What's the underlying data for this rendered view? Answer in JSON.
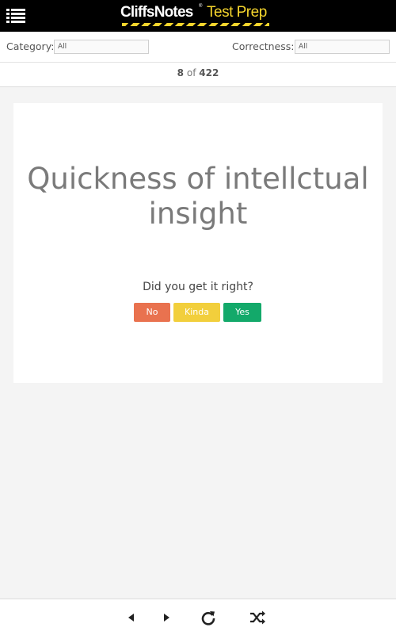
{
  "app": {
    "brand_primary": "CliffsNotes",
    "brand_secondary": "Test Prep",
    "registered": "®",
    "accent_color": "#f5d52d"
  },
  "filters": {
    "category_label": "Category:",
    "category_value": "All",
    "correctness_label": "Correctness:",
    "correctness_value": "All"
  },
  "counter": {
    "current": "8",
    "separator": "of",
    "total": "422"
  },
  "card": {
    "term": "Quickness of intellctual insight",
    "question": "Did you get it right?"
  },
  "answers": {
    "no": {
      "label": "No",
      "color": "#e9724f"
    },
    "kinda": {
      "label": "Kinda",
      "color": "#f2cf3c"
    },
    "yes": {
      "label": "Yes",
      "color": "#13a96a"
    }
  },
  "navigation": {
    "icons": [
      "previous-icon",
      "next-icon",
      "reload-icon",
      "shuffle-icon"
    ]
  }
}
